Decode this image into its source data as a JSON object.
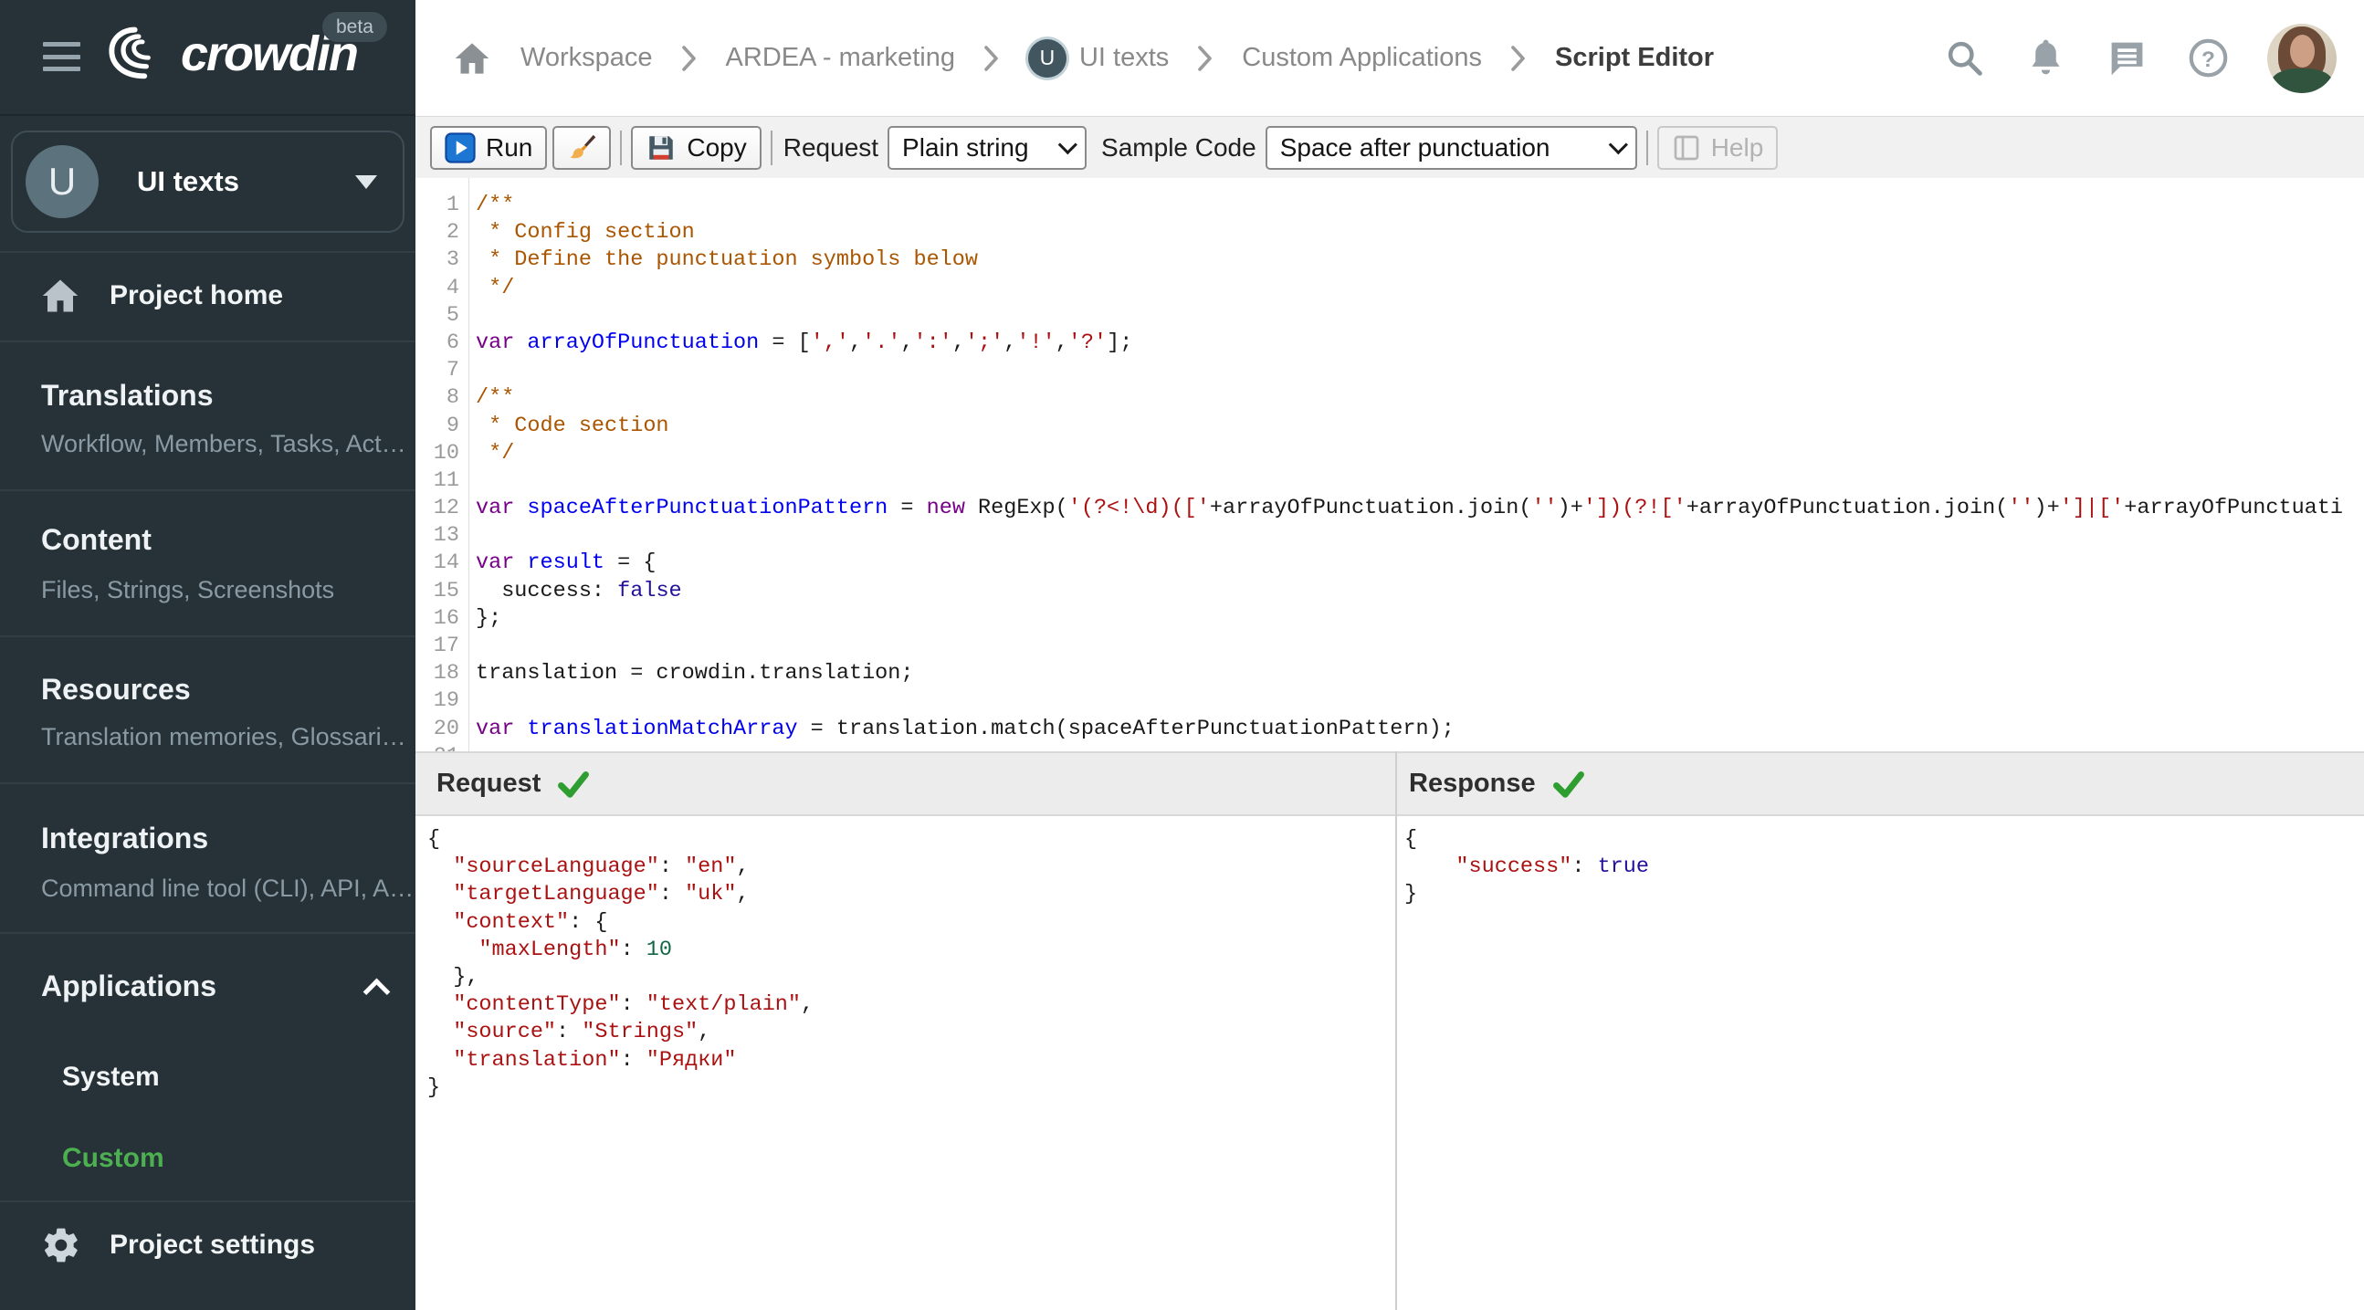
{
  "sidebar": {
    "beta_badge": "beta",
    "logo_text": "crowdin",
    "project_switcher": {
      "avatar_letter": "U",
      "name": "UI texts"
    },
    "project_home": "Project home",
    "sections": [
      {
        "title": "Translations",
        "subtitle": "Workflow, Members, Tasks, Act…"
      },
      {
        "title": "Content",
        "subtitle": "Files, Strings, Screenshots"
      },
      {
        "title": "Resources",
        "subtitle": "Translation memories, Glossari…"
      },
      {
        "title": "Integrations",
        "subtitle": "Command line tool (CLI), API, A…"
      },
      {
        "title": "Applications"
      }
    ],
    "applications_children": [
      {
        "label": "System",
        "selected": false
      },
      {
        "label": "Custom",
        "selected": true
      }
    ],
    "project_settings": "Project settings",
    "accent_green": "#4caf50"
  },
  "breadcrumb": {
    "items": [
      "Workspace",
      "ARDEA - marketing",
      "UI texts",
      "Custom Applications",
      "Script Editor"
    ],
    "ui_texts_avatar_letter": "U"
  },
  "header_icons": [
    "search-icon",
    "notifications-bell-icon",
    "messages-icon",
    "help-icon",
    "user-avatar"
  ],
  "toolbar": {
    "run_label": "Run",
    "copy_label": "Copy",
    "request_label": "Request",
    "request_value": "Plain string",
    "sample_code_label": "Sample Code",
    "sample_code_value": "Space after punctuation",
    "help_label": "Help"
  },
  "editor": {
    "lines": [
      [
        [
          "c",
          "/**"
        ]
      ],
      [
        [
          "c",
          " * Config section"
        ]
      ],
      [
        [
          "c",
          " * Define the punctuation symbols below"
        ]
      ],
      [
        [
          "c",
          " */"
        ]
      ],
      [],
      [
        [
          "k",
          "var "
        ],
        [
          "d",
          "arrayOfPunctuation"
        ],
        [
          "p",
          " = ["
        ],
        [
          "s",
          "','"
        ],
        [
          "p",
          ","
        ],
        [
          "s",
          "'.'"
        ],
        [
          "p",
          ","
        ],
        [
          "s",
          "':'"
        ],
        [
          "p",
          ","
        ],
        [
          "s",
          "';'"
        ],
        [
          "p",
          ","
        ],
        [
          "s",
          "'!'"
        ],
        [
          "p",
          ","
        ],
        [
          "s",
          "'?'"
        ],
        [
          "p",
          "];"
        ]
      ],
      [],
      [
        [
          "c",
          "/**"
        ]
      ],
      [
        [
          "c",
          " * Code section"
        ]
      ],
      [
        [
          "c",
          " */"
        ]
      ],
      [],
      [
        [
          "k",
          "var "
        ],
        [
          "d",
          "spaceAfterPunctuationPattern"
        ],
        [
          "p",
          " = "
        ],
        [
          "k",
          "new"
        ],
        [
          "p",
          " RegExp("
        ],
        [
          "s",
          "'(?<!\\d)(['"
        ],
        [
          "p",
          "+arrayOfPunctuation.join("
        ],
        [
          "s",
          "''"
        ],
        [
          "p",
          ")+"
        ],
        [
          "s",
          "'])(?!['"
        ],
        [
          "p",
          "+arrayOfPunctuation.join("
        ],
        [
          "s",
          "''"
        ],
        [
          "p",
          ")+"
        ],
        [
          "s",
          "']|['"
        ],
        [
          "p",
          "+arrayOfPunctuati"
        ]
      ],
      [],
      [
        [
          "k",
          "var "
        ],
        [
          "d",
          "result"
        ],
        [
          "p",
          " = {"
        ]
      ],
      [
        [
          "p",
          "  success: "
        ],
        [
          "a",
          "false"
        ]
      ],
      [
        [
          "p",
          "};"
        ]
      ],
      [],
      [
        [
          "p",
          "translation = crowdin.translation;"
        ]
      ],
      [],
      [
        [
          "k",
          "var "
        ],
        [
          "d",
          "translationMatchArray"
        ],
        [
          "p",
          " = translation.match(spaceAfterPunctuationPattern);"
        ]
      ],
      []
    ]
  },
  "request_panel": {
    "title": "Request",
    "status": "success-check",
    "lines": [
      [
        [
          "p",
          "{"
        ]
      ],
      [
        [
          "p",
          "  "
        ],
        [
          "s",
          "\"sourceLanguage\""
        ],
        [
          "p",
          ": "
        ],
        [
          "s",
          "\"en\""
        ],
        [
          "p",
          ","
        ]
      ],
      [
        [
          "p",
          "  "
        ],
        [
          "s",
          "\"targetLanguage\""
        ],
        [
          "p",
          ": "
        ],
        [
          "s",
          "\"uk\""
        ],
        [
          "p",
          ","
        ]
      ],
      [
        [
          "p",
          "  "
        ],
        [
          "s",
          "\"context\""
        ],
        [
          "p",
          ": {"
        ]
      ],
      [
        [
          "p",
          "    "
        ],
        [
          "s",
          "\"maxLength\""
        ],
        [
          "p",
          ": "
        ],
        [
          "n",
          "10"
        ]
      ],
      [
        [
          "p",
          "  },"
        ]
      ],
      [
        [
          "p",
          "  "
        ],
        [
          "s",
          "\"contentType\""
        ],
        [
          "p",
          ": "
        ],
        [
          "s",
          "\"text/plain\""
        ],
        [
          "p",
          ","
        ]
      ],
      [
        [
          "p",
          "  "
        ],
        [
          "s",
          "\"source\""
        ],
        [
          "p",
          ": "
        ],
        [
          "s",
          "\"Strings\""
        ],
        [
          "p",
          ","
        ]
      ],
      [
        [
          "p",
          "  "
        ],
        [
          "s",
          "\"translation\""
        ],
        [
          "p",
          ": "
        ],
        [
          "s",
          "\"Рядки\""
        ]
      ],
      [
        [
          "p",
          "}"
        ]
      ]
    ]
  },
  "response_panel": {
    "title": "Response",
    "status": "success-check",
    "lines": [
      [
        [
          "p",
          "{"
        ]
      ],
      [
        [
          "p",
          "    "
        ],
        [
          "s",
          "\"success\""
        ],
        [
          "p",
          ": "
        ],
        [
          "a",
          "true"
        ]
      ],
      [
        [
          "p",
          "}"
        ]
      ]
    ]
  }
}
